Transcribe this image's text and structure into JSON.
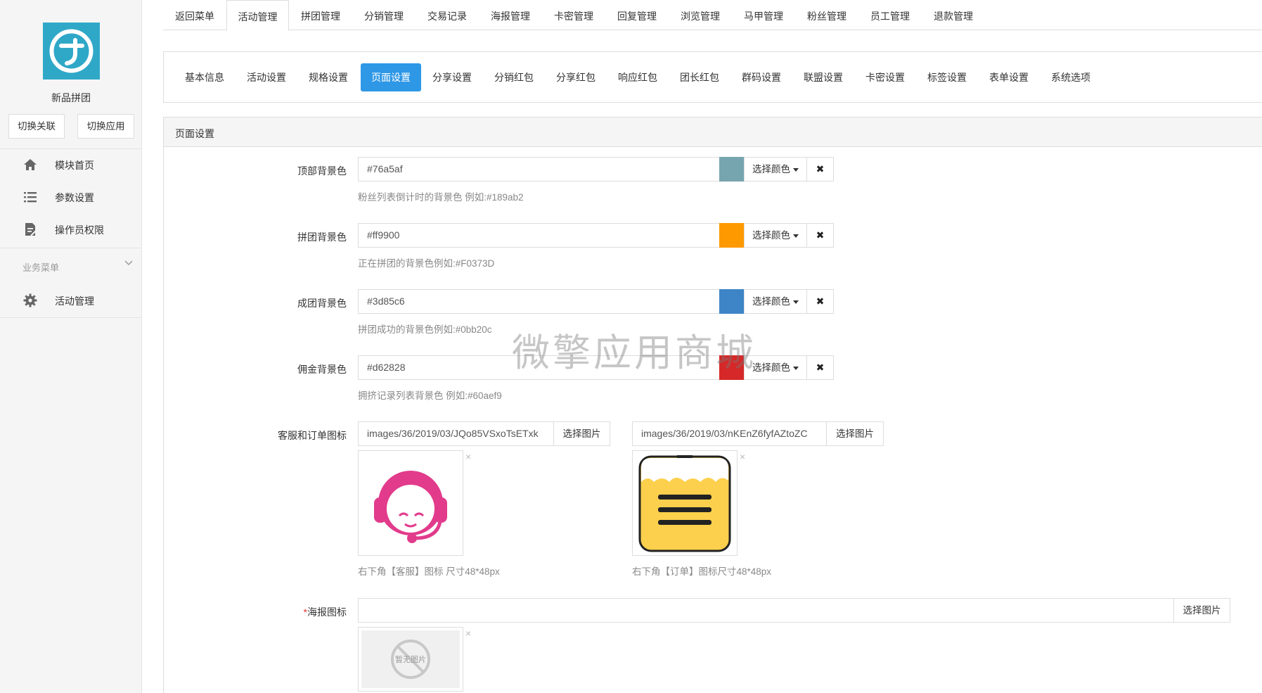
{
  "sidebar": {
    "app_name": "新品拼团",
    "switch_left": "切换关联",
    "switch_right": "切换应用",
    "menu": [
      {
        "label": "模块首页",
        "icon": "home-icon"
      },
      {
        "label": "参数设置",
        "icon": "list-icon"
      },
      {
        "label": "操作员权限",
        "icon": "document-icon"
      }
    ],
    "biz_title": "业务菜单",
    "biz_items": [
      {
        "label": "活动管理",
        "icon": "gear-icon"
      }
    ]
  },
  "topnav": [
    "返回菜单",
    "活动管理",
    "拼团管理",
    "分销管理",
    "交易记录",
    "海报管理",
    "卡密管理",
    "回复管理",
    "浏览管理",
    "马甲管理",
    "粉丝管理",
    "员工管理",
    "退款管理"
  ],
  "topnav_active": "活动管理",
  "subnav": [
    "基本信息",
    "活动设置",
    "规格设置",
    "页面设置",
    "分享设置",
    "分销红包",
    "分享红包",
    "响应红包",
    "团长红包",
    "群码设置",
    "联盟设置",
    "卡密设置",
    "标签设置",
    "表单设置",
    "系统选项"
  ],
  "subnav_active": "页面设置",
  "panel_title": "页面设置",
  "color_rows": [
    {
      "label": "顶部背景色",
      "value": "#76a5af",
      "swatch": "#76a5af",
      "help": "粉丝列表倒计时的背景色 例如:#189ab2",
      "pick": "选择颜色",
      "clear": "✖"
    },
    {
      "label": "拼团背景色",
      "value": "#ff9900",
      "swatch": "#ff9900",
      "help": "正在拼团的背景色例如:#F0373D",
      "pick": "选择颜色",
      "clear": "✖"
    },
    {
      "label": "成团背景色",
      "value": "#3d85c6",
      "swatch": "#3d85c6",
      "help": "拼团成功的背景色例如:#0bb20c",
      "pick": "选择颜色",
      "clear": "✖"
    },
    {
      "label": "佣金背景色",
      "value": "#d62828",
      "swatch": "#d62828",
      "help": "拥挤记录列表背景色 例如:#60aef9",
      "pick": "选择颜色",
      "clear": "✖"
    }
  ],
  "icon_row": {
    "label": "客服和订单图标",
    "left": {
      "path": "images/36/2019/03/JQo85VSxoTsETxk",
      "button": "选择图片",
      "help": "右下角【客服】图标 尺寸48*48px",
      "remove": "×",
      "image": "customer-service-icon"
    },
    "right": {
      "path": "images/36/2019/03/nKEnZ6fyfAZtoZC",
      "button": "选择图片",
      "help": "右下角【订单】图标尺寸48*48px",
      "remove": "×",
      "image": "order-icon"
    }
  },
  "poster_row": {
    "required_mark": "*",
    "label": "海报图标",
    "path": "",
    "button": "选择图片",
    "remove": "×",
    "placeholder_text": "暂无图片"
  },
  "watermark": "微擎应用商城",
  "colors": {
    "accent": "#2e97e6",
    "logo": "#2fa8c8",
    "sidebar_bg": "#f5f5f5"
  }
}
